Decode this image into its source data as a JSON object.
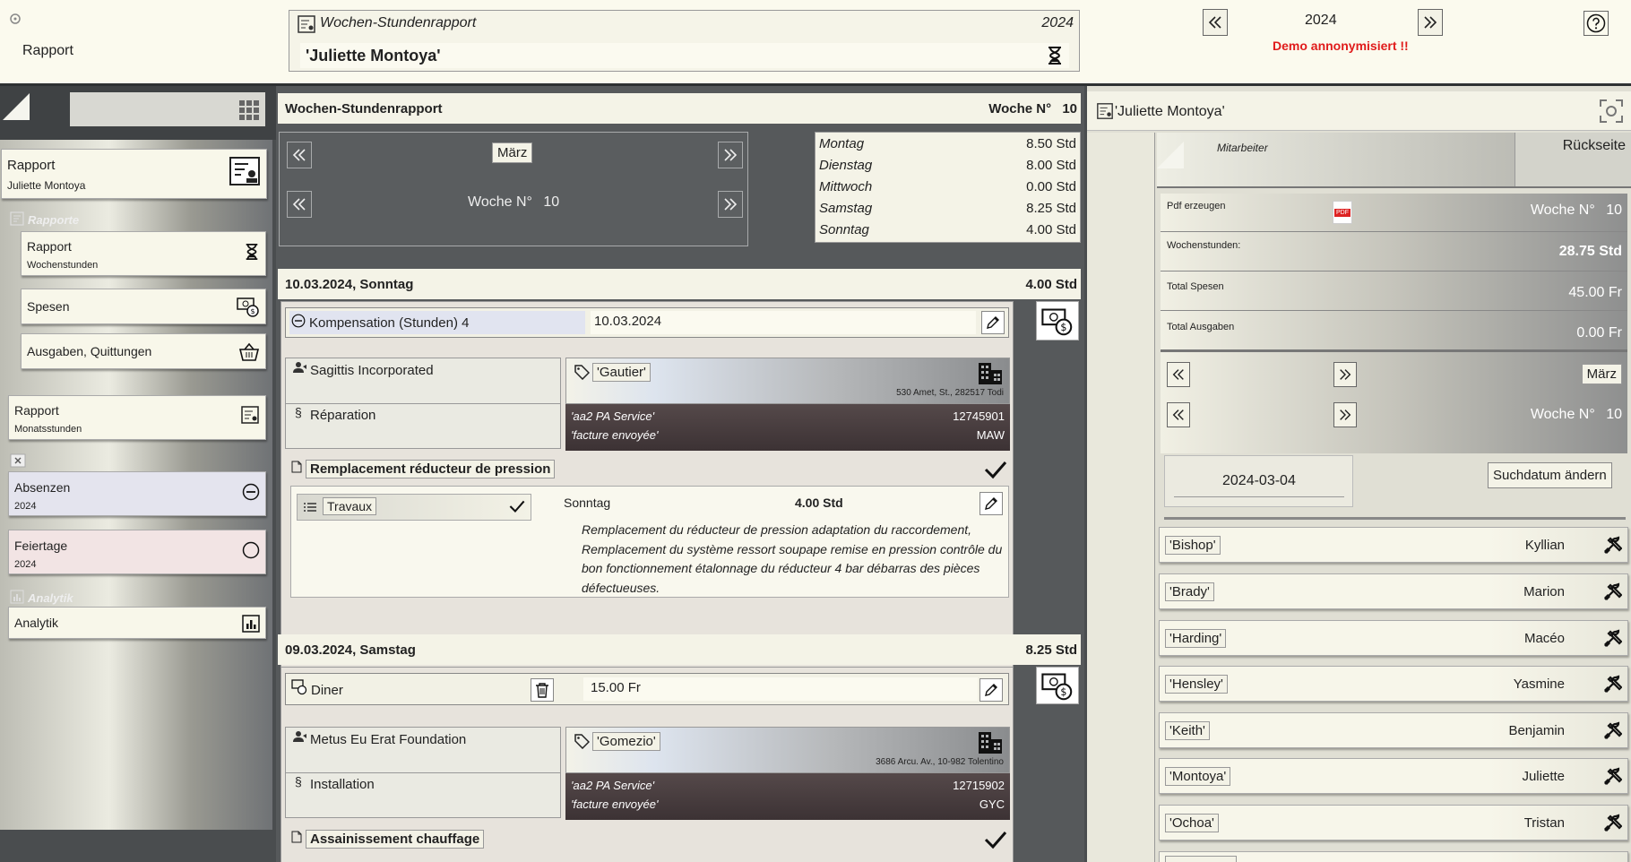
{
  "header": {
    "rapport_label": "Rapport",
    "doc_title": "Wochen-Stundenrapport",
    "doc_year": "2024",
    "person": "'Juliette Montoya'",
    "nav_year": "2024",
    "demo_notice": "Demo annonymisiert !!"
  },
  "sidebar": {
    "main_card": {
      "title": "Rapport",
      "subtitle": "Juliette Montoya"
    },
    "rapporte_section": "Rapporte",
    "items": [
      {
        "title": "Rapport",
        "subtitle": "Wochenstunden"
      },
      {
        "title": "Spesen",
        "subtitle": ""
      },
      {
        "title": "Ausgaben, Quittungen",
        "subtitle": ""
      },
      {
        "title": "Rapport",
        "subtitle": "Monatsstunden"
      },
      {
        "title": "Absenzen",
        "subtitle": "2024"
      },
      {
        "title": "Feiertage",
        "subtitle": "2024"
      }
    ],
    "analytik_section": "Analytik",
    "analytik_item": "Analytik"
  },
  "middle": {
    "title": "Wochen-Stundenrapport",
    "week_label": "Woche N°",
    "week_number": "10",
    "month": "März",
    "week_nav_label": "Woche N°",
    "week_nav_number": "10",
    "week_summary": [
      {
        "day": "Montag",
        "hours": "8.50 Std"
      },
      {
        "day": "Dienstag",
        "hours": "8.00 Std"
      },
      {
        "day": "Mittwoch",
        "hours": "0.00 Std"
      },
      {
        "day": "Samstag",
        "hours": "8.25 Std"
      },
      {
        "day": "Sonntag",
        "hours": "4.00 Std"
      }
    ],
    "days": [
      {
        "header": "10.03.2024,  Sonntag",
        "total": "4.00 Std",
        "comp_title": "Kompensation (Stunden) 4",
        "comp_date": "10.03.2024",
        "company": "Sagittis Incorporated",
        "category": "Réparation",
        "tag": "'Gautier'",
        "address": "530 Amet, St., 282517 Todi",
        "pa": "'aa2 PA Service'",
        "pa_num": "12745901",
        "invoice": "'facture envoyée'",
        "invoice_code": "MAW",
        "job_title": "Remplacement réducteur de pression",
        "work_type": "Travaux",
        "work_day": "Sonntag",
        "work_hours": "4.00 Std",
        "description": "Remplacement du réducteur de pression adaptation du raccordement, Remplacement du système ressort soupape remise en pression contrôle du bon fonctionnement étalonnage du réducteur 4 bar débarras des pièces défectueuses."
      },
      {
        "header": "09.03.2024,  Samstag",
        "total": "8.25 Std",
        "expense_title": "Diner",
        "expense_amount": "15.00 Fr",
        "company": "Metus Eu Erat Foundation",
        "category": "Installation",
        "tag": "'Gomezio'",
        "address": "3686 Arcu. Av., 10-982 Tolentino",
        "pa": "'aa2 PA Service'",
        "pa_num": "12715902",
        "invoice": "'facture envoyée'",
        "invoice_code": "GYC",
        "job_title": "Assainissement chauffage"
      }
    ]
  },
  "right": {
    "title": "'Juliette Montoya'",
    "mitarbeiter": "Mitarbeiter",
    "rueckseite": "Rückseite",
    "pdf_label": "Pdf erzeugen",
    "pdf_icon_text": "PDF",
    "pdf_week_label": "Woche N°",
    "pdf_week_number": "10",
    "wochenstunden_label": "Wochenstunden:",
    "wochenstunden_value": "28.75 Std",
    "spesen_label": "Total Spesen",
    "spesen_value": "45.00 Fr",
    "ausgaben_label": "Total Ausgaben",
    "ausgaben_value": "0.00 Fr",
    "month": "März",
    "week_label": "Woche N°",
    "week_number": "10",
    "search_date": "2024-03-04",
    "search_button": "Suchdatum ändern",
    "employees": [
      {
        "last": "'Bishop'",
        "first": "Kyllian"
      },
      {
        "last": "'Brady'",
        "first": "Marion"
      },
      {
        "last": "'Harding'",
        "first": "Macéo"
      },
      {
        "last": "'Hensley'",
        "first": "Yasmine"
      },
      {
        "last": "'Keith'",
        "first": "Benjamin"
      },
      {
        "last": "'Montoya'",
        "first": "Juliette"
      },
      {
        "last": "'Ochoa'",
        "first": "Tristan"
      }
    ]
  }
}
